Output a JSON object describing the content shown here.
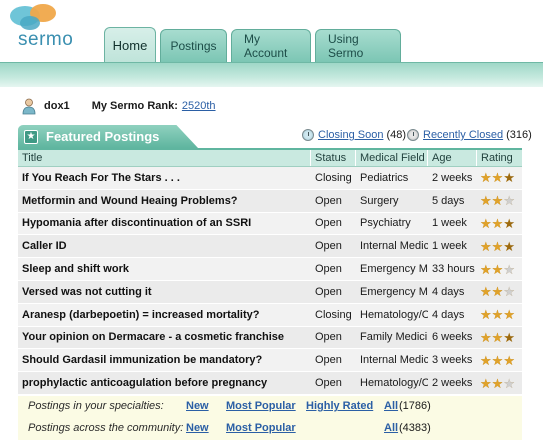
{
  "app": {
    "logo_text": "sermo"
  },
  "nav": {
    "tabs": [
      {
        "label": "Home",
        "active": true
      },
      {
        "label": "Postings",
        "active": false
      },
      {
        "label": "My Account",
        "active": false
      },
      {
        "label": "Using Sermo",
        "active": false
      }
    ]
  },
  "user": {
    "name": "dox1",
    "rank_label": "My Sermo Rank:",
    "rank_value": "2520th"
  },
  "featured": {
    "title": "Featured Postings",
    "closing_soon_label": "Closing Soon",
    "closing_soon_count": "(48)",
    "recently_closed_label": "Recently Closed",
    "recently_closed_count": "(316)"
  },
  "table": {
    "headers": [
      "Title",
      "Status",
      "Medical Field",
      "Age",
      "Rating"
    ],
    "rows": [
      {
        "title": "If You Reach For The Stars . . .",
        "status": "Closing",
        "field": "Pediatrics",
        "age": "2 weeks",
        "rating": 2.5
      },
      {
        "title": "Metformin and Wound Heaing Problems?",
        "status": "Open",
        "field": "Surgery",
        "age": "5 days",
        "rating": 2
      },
      {
        "title": "Hypomania after discontinuation of an SSRI",
        "status": "Open",
        "field": "Psychiatry",
        "age": "1 week",
        "rating": 2.5
      },
      {
        "title": "Caller ID",
        "status": "Open",
        "field": "Internal Medic",
        "age": "1 week",
        "rating": 2.5
      },
      {
        "title": "Sleep and shift work",
        "status": "Open",
        "field": "Emergency Me",
        "age": "33 hours",
        "rating": 2
      },
      {
        "title": "Versed was not cutting it",
        "status": "Open",
        "field": "Emergency Me",
        "age": "4 days",
        "rating": 2
      },
      {
        "title": "Aranesp (darbepoetin) = increased mortality?",
        "status": "Closing",
        "field": "Hematology/O",
        "age": "4 days",
        "rating": 3
      },
      {
        "title": "Your opinion on Dermacare - a cosmetic franchise",
        "status": "Open",
        "field": "Family Medicir",
        "age": "6 weeks",
        "rating": 2.5
      },
      {
        "title": "Should Gardasil immunization be mandatory?",
        "status": "Open",
        "field": "Internal Medic",
        "age": "3 weeks",
        "rating": 3
      },
      {
        "title": "prophylactic anticoagulation before pregnancy",
        "status": "Open",
        "field": "Hematology/O",
        "age": "2 weeks",
        "rating": 2
      }
    ]
  },
  "footer": {
    "specialties": {
      "label": "Postings in your specialties:",
      "new": "New",
      "most_popular": "Most Popular",
      "highly_rated": "Highly Rated",
      "all": "All",
      "all_count": "(1786)"
    },
    "community": {
      "label": "Postings across the community:",
      "new": "New",
      "most_popular": "Most Popular",
      "all": "All",
      "all_count": "(4383)"
    }
  },
  "colors": {
    "accent": "#5fb59f",
    "link": "#2b5fa5",
    "star": "#e0a22a"
  },
  "icons": {
    "user": "user-icon",
    "clock": "clock-icon",
    "star": "star-icon"
  }
}
